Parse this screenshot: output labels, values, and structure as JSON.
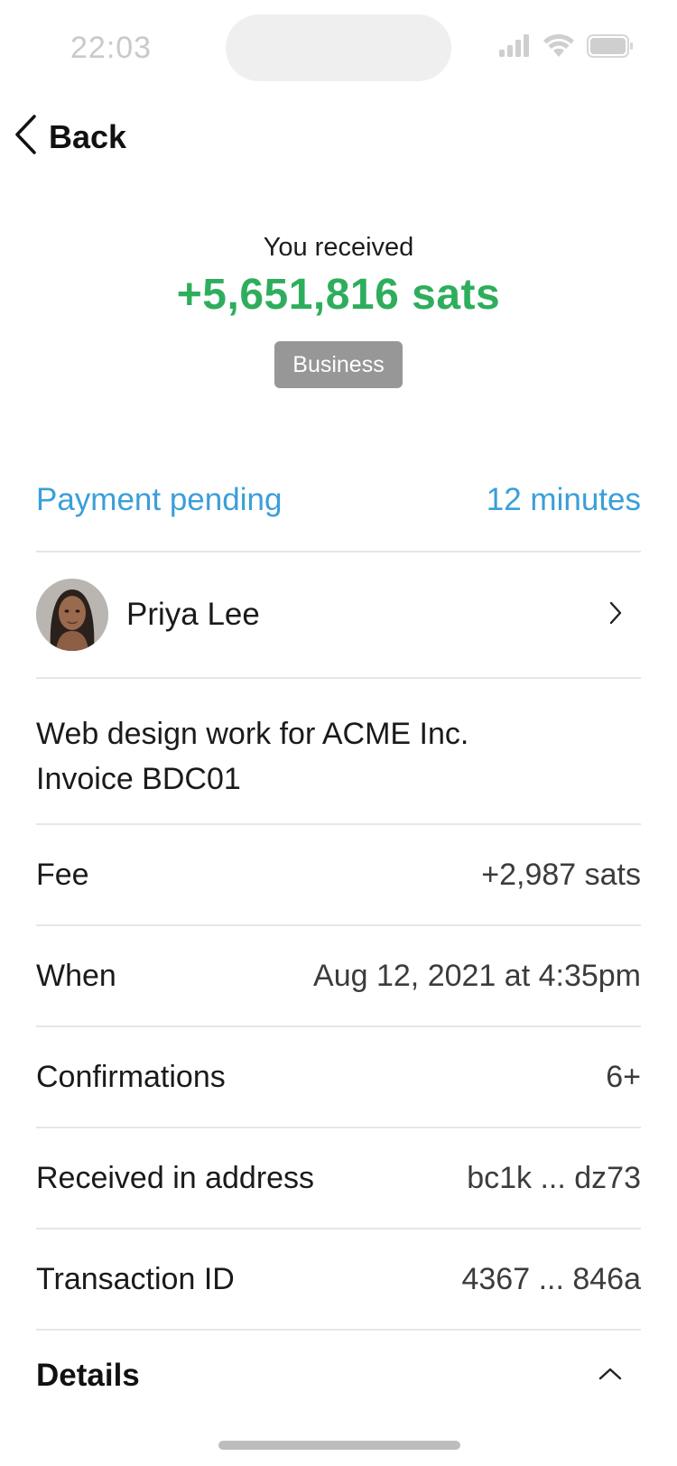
{
  "status_bar": {
    "time": "22:03"
  },
  "nav": {
    "back_label": "Back"
  },
  "transaction": {
    "caption": "You received",
    "amount": "+5,651,816 sats",
    "tag": "Business",
    "pending_label": "Payment pending",
    "pending_time": "12 minutes"
  },
  "contact": {
    "name": "Priya Lee"
  },
  "memo": {
    "line1": "Web design work for ACME Inc.",
    "line2": "Invoice BDC01"
  },
  "rows": [
    {
      "label": "Fee",
      "value": "+2,987 sats"
    },
    {
      "label": "When",
      "value": "Aug 12, 2021 at 4:35pm"
    },
    {
      "label": "Confirmations",
      "value": "6+"
    },
    {
      "label": "Received in address",
      "value": "bc1k ... dz73"
    },
    {
      "label": "Transaction ID",
      "value": "4367 ... 846a"
    }
  ],
  "details": {
    "label": "Details"
  },
  "colors": {
    "amount": "#2eae5d",
    "pending": "#3a9fd9",
    "tag_bg": "#979797"
  },
  "icons": {
    "back": "chevron-left-icon",
    "contact_chevron": "chevron-right-icon",
    "details_chevron": "chevron-up-icon"
  }
}
